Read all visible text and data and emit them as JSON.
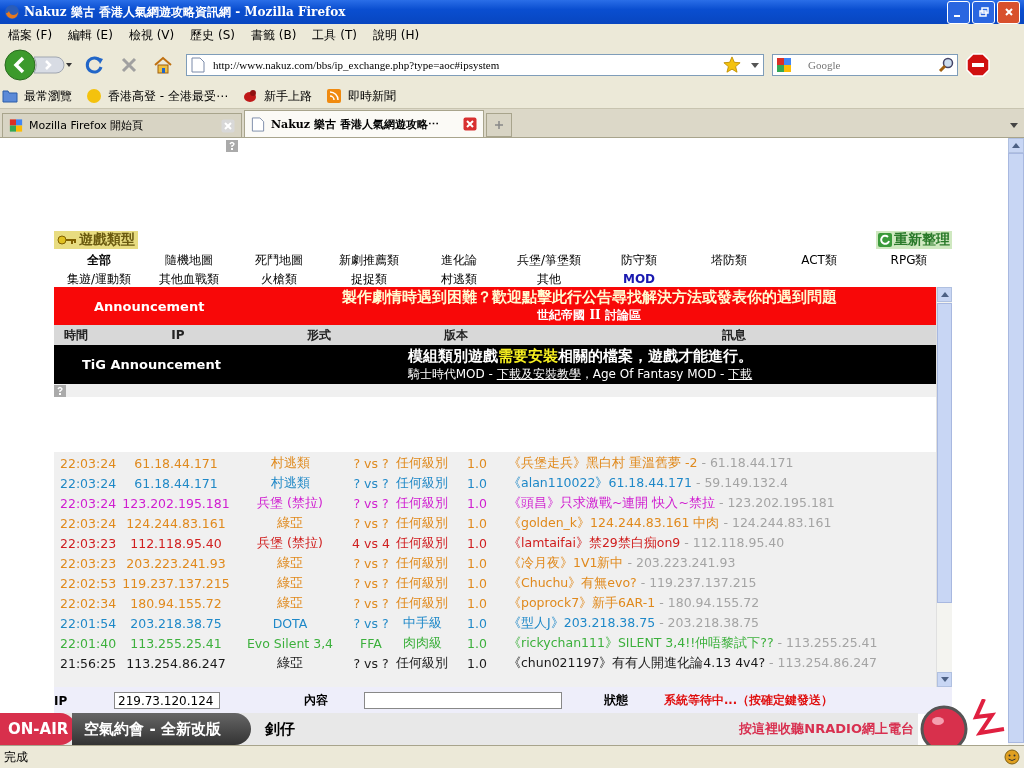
{
  "window": {
    "title": "Nakuz 樂古 香港人氣網遊攻略資訊網 - Mozilla Firefox"
  },
  "menu": [
    "檔案 (F)",
    "編輯 (E)",
    "檢視 (V)",
    "歷史 (S)",
    "書籤 (B)",
    "工具 (T)",
    "說明 (H)"
  ],
  "toolbar": {
    "url": "http://www.nakuz.com/bbs/ip_exchange.php?type=aoc#ipsystem",
    "search_placeholder": "Google"
  },
  "bookmarks": [
    {
      "label": "最常瀏覽",
      "kind": "folder"
    },
    {
      "label": "香港高登 - 全港最受⋯",
      "kind": "dot"
    },
    {
      "label": "新手上路",
      "kind": "bug"
    },
    {
      "label": "即時新聞",
      "kind": "feed"
    }
  ],
  "tabs": [
    {
      "label": "Mozilla Firefox 開始頁",
      "selected": false
    },
    {
      "label": "Nakuz 樂古 香港人氣網遊攻略⋯",
      "selected": true
    }
  ],
  "page": {
    "section_title": "遊戲類型",
    "refresh": "重新整理",
    "categories": [
      {
        "label": "全部",
        "selected": true,
        "highlight": false
      },
      {
        "label": "隨機地圖",
        "selected": false,
        "highlight": false
      },
      {
        "label": "死鬥地圖",
        "selected": false,
        "highlight": false
      },
      {
        "label": "新劇推薦類",
        "selected": false,
        "highlight": false
      },
      {
        "label": "進化論",
        "selected": false,
        "highlight": false
      },
      {
        "label": "兵堡/箏堡類",
        "selected": false,
        "highlight": false
      },
      {
        "label": "防守類",
        "selected": false,
        "highlight": false
      },
      {
        "label": "塔防類",
        "selected": false,
        "highlight": false
      },
      {
        "label": "ACT類",
        "selected": false,
        "highlight": false
      },
      {
        "label": "RPG類",
        "selected": false,
        "highlight": false
      },
      {
        "label": "集遊/運動類",
        "selected": false,
        "highlight": false
      },
      {
        "label": "其他血戰類",
        "selected": false,
        "highlight": false
      },
      {
        "label": "火槍類",
        "selected": false,
        "highlight": false
      },
      {
        "label": "捉捉類",
        "selected": false,
        "highlight": false
      },
      {
        "label": "村逃類",
        "selected": false,
        "highlight": false
      },
      {
        "label": "其他",
        "selected": false,
        "highlight": false
      },
      {
        "label": "MOD",
        "selected": true,
        "highlight": true
      }
    ],
    "announcement": {
      "label": "Announcement",
      "text": "製作劇情時遇到困難？歡迎點擊此行公告尋找解決方法或發表你的遇到問題",
      "subtext": "世紀帝國 II 討論區"
    },
    "columns": [
      "時間",
      "IP",
      "形式",
      "版本",
      "訊息"
    ],
    "tig_announcement": {
      "label": "TiG Announcement",
      "text": "模組類別遊戲**需要安裝**相關的檔案，遊戲才能進行。",
      "parts": [
        {
          "text": "騎士時代MOD - ",
          "link": false
        },
        {
          "text": "下載及安裝教學",
          "link": true
        },
        {
          "text": "，Age Of Fantasy MOD - ",
          "link": false
        },
        {
          "text": "下載",
          "link": true
        }
      ]
    },
    "rows": [
      {
        "time": "22:03:24",
        "ip": "61.18.44.171",
        "type": "村逃類",
        "players": "? vs ?",
        "level": "任何級別",
        "version": "1.0",
        "message": "《兵堡走兵》黑白村 重溫舊夢 -2",
        "source": "- 61.18.44.171",
        "color": "#e0891c"
      },
      {
        "time": "22:03:24",
        "ip": "61.18.44.171",
        "type": "村逃類",
        "players": "? vs ?",
        "level": "任何級別",
        "version": "1.0",
        "message": "《alan110022》61.18.44.171",
        "source": "- 59.149.132.4",
        "color": "#1e88c8"
      },
      {
        "time": "22:03:24",
        "ip": "123.202.195.181",
        "type": "兵堡 (禁拉)",
        "players": "? vs ?",
        "level": "任何級別",
        "version": "1.0",
        "message": "《頭昌》只求激戰~連開 快入~禁拉",
        "source": "- 123.202.195.181",
        "color": "#d01ed0"
      },
      {
        "time": "22:03:24",
        "ip": "124.244.83.161",
        "type": "綠亞",
        "players": "? vs ?",
        "level": "任何級別",
        "version": "1.0",
        "message": "《golden_k》124.244.83.161 中肉",
        "source": "- 124.244.83.161",
        "color": "#e0891c"
      },
      {
        "time": "22:03:23",
        "ip": "112.118.95.40",
        "type": "兵堡 (禁拉)",
        "players": "4 vs 4",
        "level": "任何級別",
        "version": "1.0",
        "message": "《lamtaifai》禁29禁白痴on9",
        "source": "- 112.118.95.40",
        "color": "#d01e1e"
      },
      {
        "time": "22:03:23",
        "ip": "203.223.241.93",
        "type": "綠亞",
        "players": "? vs ?",
        "level": "任何級別",
        "version": "1.0",
        "message": "《冷月夜》1V1新中",
        "source": "- 203.223.241.93",
        "color": "#e0891c"
      },
      {
        "time": "22:02:53",
        "ip": "119.237.137.215",
        "type": "綠亞",
        "players": "? vs ?",
        "level": "任何級別",
        "version": "1.0",
        "message": "《Chuchu》有無evo?",
        "source": "- 119.237.137.215",
        "color": "#e0891c"
      },
      {
        "time": "22:02:34",
        "ip": "180.94.155.72",
        "type": "綠亞",
        "players": "? vs ?",
        "level": "任何級別",
        "version": "1.0",
        "message": "《poprock7》新手6AR-1",
        "source": "- 180.94.155.72",
        "color": "#e0891c"
      },
      {
        "time": "22:01:54",
        "ip": "203.218.38.75",
        "type": "DOTA",
        "players": "? vs ?",
        "level": "中手級",
        "version": "1.0",
        "message": "《型人J》203.218.38.75",
        "source": "- 203.218.38.75",
        "color": "#1e88c8"
      },
      {
        "time": "22:01:40",
        "ip": "113.255.25.41",
        "type": "Evo Silent 3,4",
        "players": "FFA",
        "level": "肉肉級",
        "version": "1.0",
        "message": "《rickychan111》SILENT 3,4!!仲唔黎試下??",
        "source": "- 113.255.25.41",
        "color": "#3cb03c"
      },
      {
        "time": "21:56:25",
        "ip": "113.254.86.247",
        "type": "綠亞",
        "players": "? vs ?",
        "level": "任何級別",
        "version": "1.0",
        "message": "《chun021197》有有人開進化論4.13 4v4?",
        "source": "- 113.254.86.247",
        "color": "#1a1a1a"
      }
    ],
    "form": {
      "ip_label": "IP",
      "ip_value": "219.73.120.124",
      "content_label": "內容",
      "status_label": "狀態",
      "status_text": "系統等待中...（按確定鍵發送）"
    }
  },
  "radio": {
    "badge": "ON-AIR",
    "program": "空氣約會 - 全新改版",
    "host": "釗仔",
    "listen": "按這裡收聽NRADIO網上電台"
  },
  "status_bar": "完成"
}
